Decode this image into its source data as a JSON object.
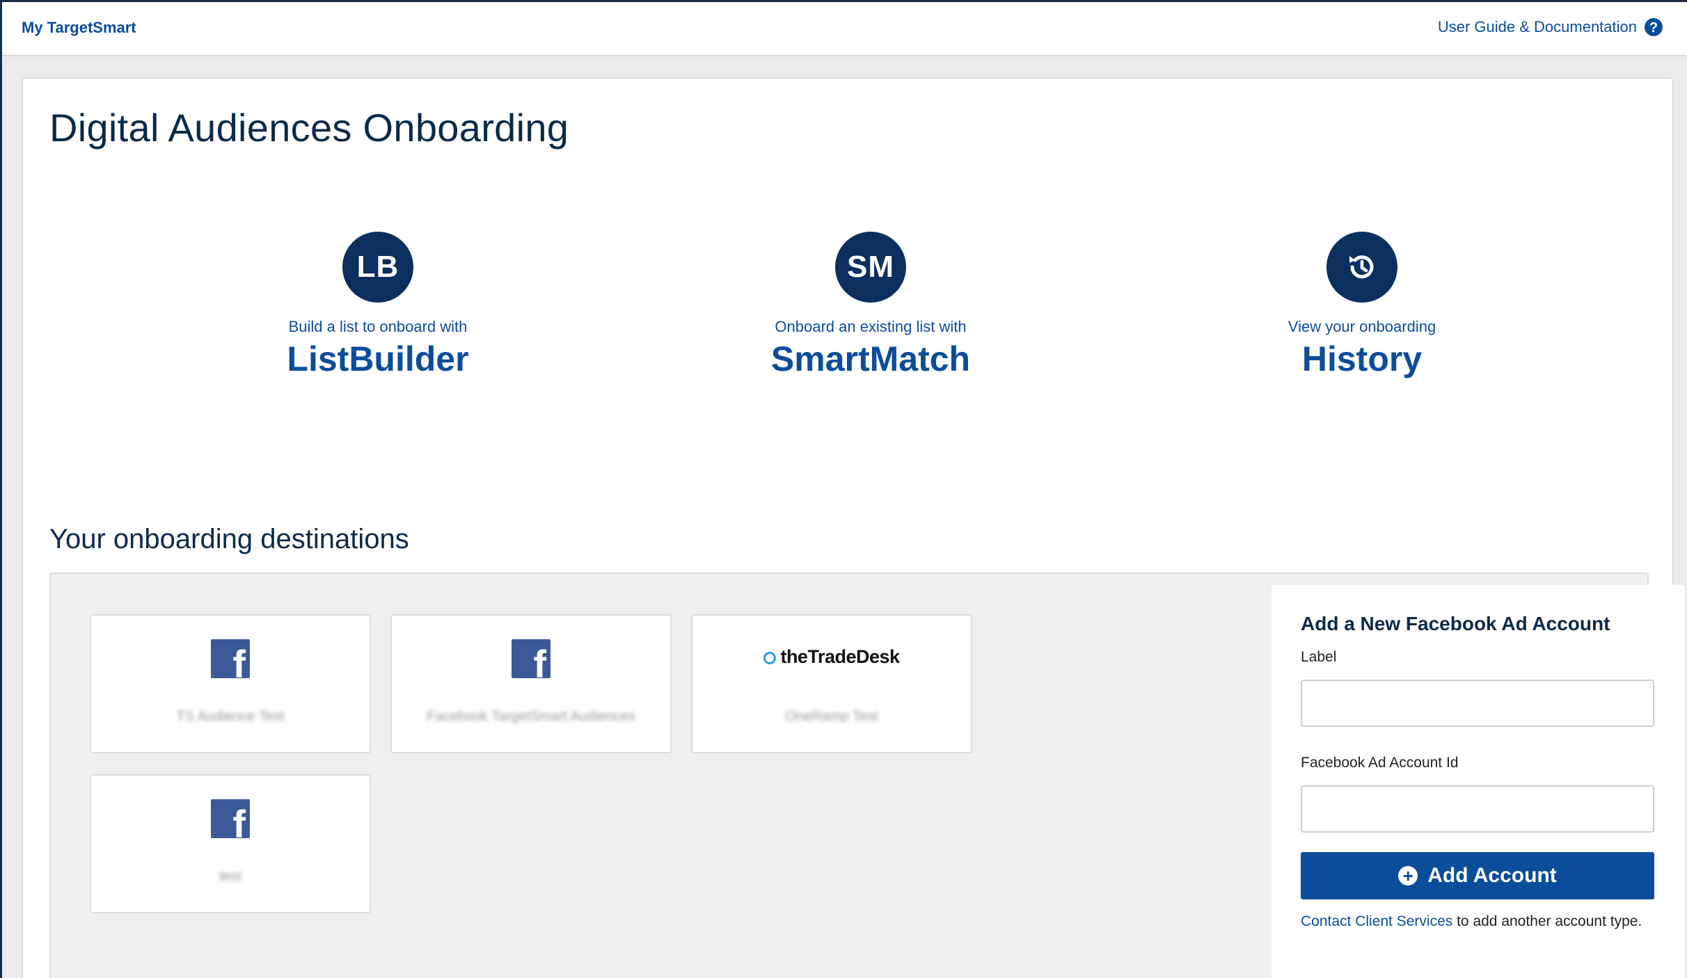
{
  "header": {
    "brand": "My TargetSmart",
    "help_link": "User Guide & Documentation"
  },
  "page": {
    "title": "Digital Audiences Onboarding"
  },
  "options": [
    {
      "badge": "LB",
      "pre": "Build a list to onboard with",
      "main": "ListBuilder"
    },
    {
      "badge": "SM",
      "pre": "Onboard an existing list with",
      "main": "SmartMatch"
    },
    {
      "badge": "",
      "icon": "history-icon",
      "pre": "View your onboarding",
      "main": "History"
    }
  ],
  "destinations": {
    "title": "Your onboarding destinations",
    "items": [
      {
        "type": "facebook",
        "icon": "facebook-icon",
        "name": "TS Audience Test"
      },
      {
        "type": "facebook",
        "icon": "facebook-icon",
        "name": "Facebook TargetSmart Audiences"
      },
      {
        "type": "tradedesk",
        "icon": "tradedesk-logo",
        "logo_text": "theTradeDesk",
        "name": "OneRamp Test"
      },
      {
        "type": "facebook",
        "icon": "facebook-icon",
        "name": "test"
      }
    ]
  },
  "add_account": {
    "title": "Add a New Facebook Ad Account",
    "label_label": "Label",
    "label_value": "",
    "account_id_label": "Facebook Ad Account Id",
    "account_id_value": "",
    "button": "Add Account",
    "contact_link": "Contact Client Services",
    "contact_rest": " to add another account type."
  },
  "colors": {
    "brand_blue": "#0b4d9b",
    "navy": "#0b2f5e",
    "facebook": "#3b5998"
  }
}
